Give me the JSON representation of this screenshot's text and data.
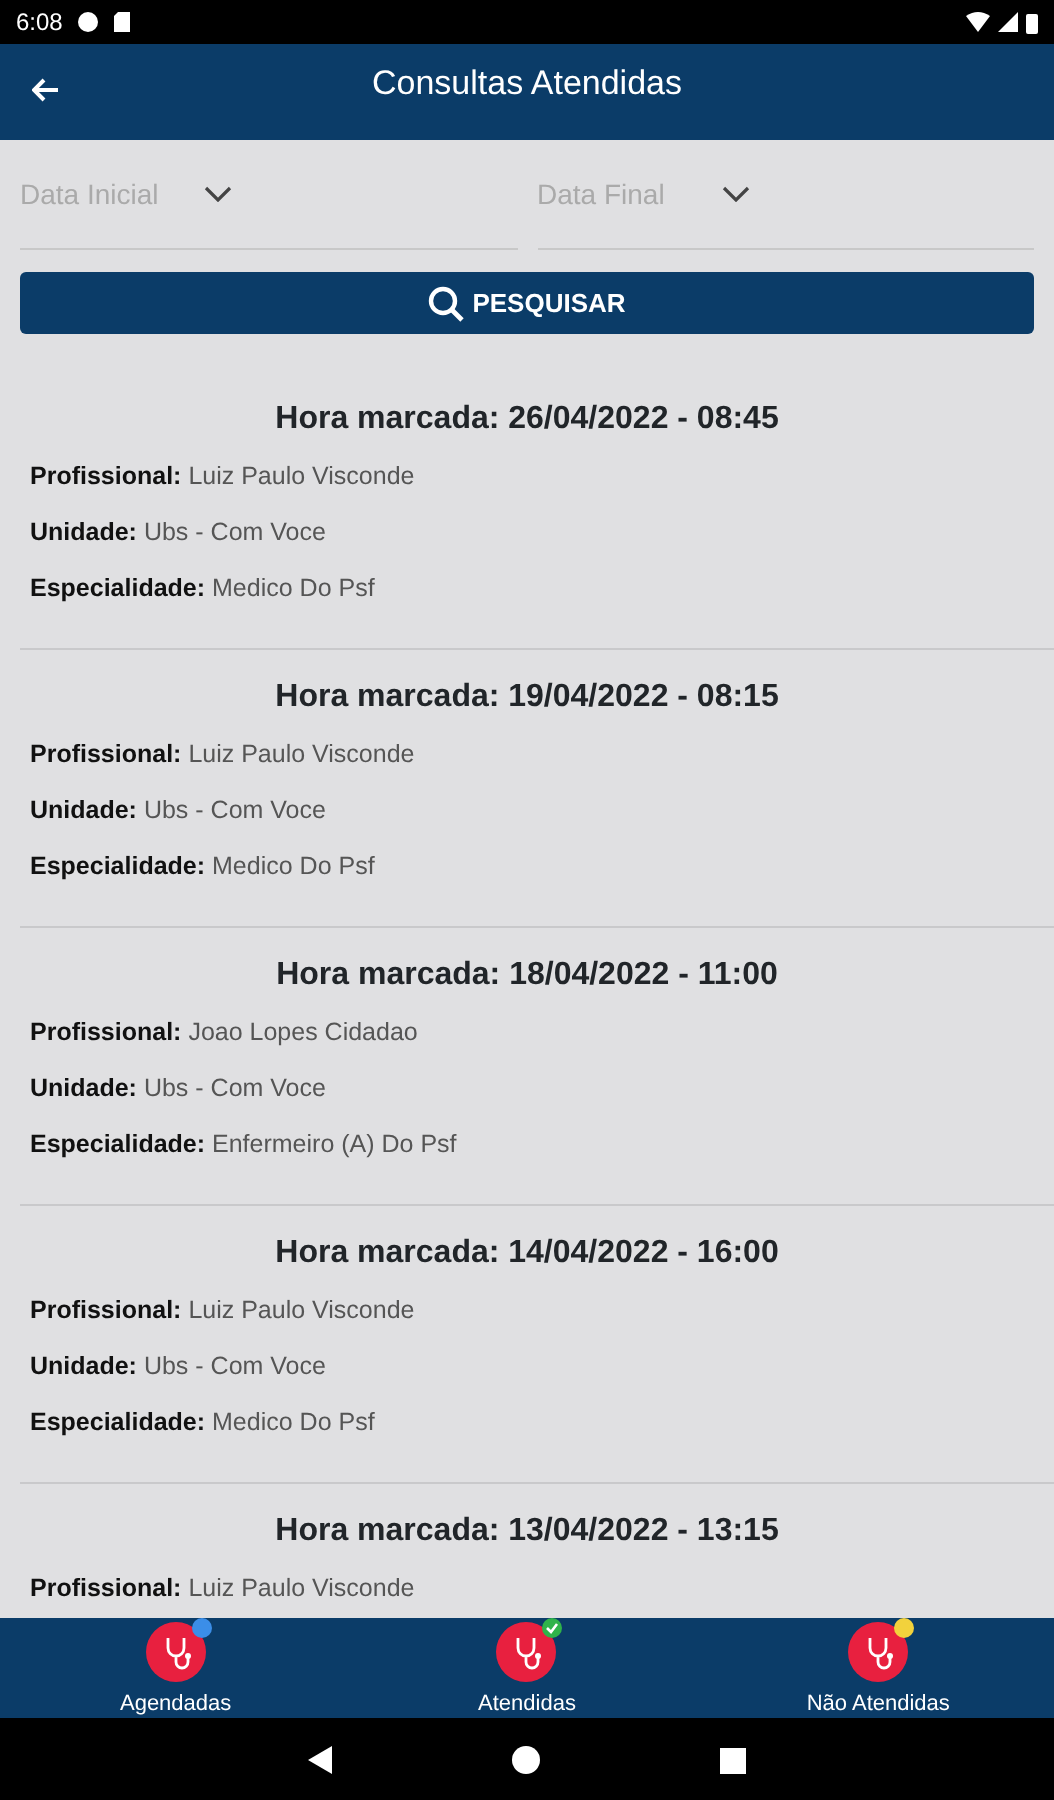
{
  "status_bar": {
    "time": "6:08"
  },
  "header": {
    "title": "Consultas Atendidas"
  },
  "filters": [
    {
      "placeholder": "Data Inicial"
    },
    {
      "placeholder": "Data Final"
    }
  ],
  "search_button": {
    "label": "PESQUISAR"
  },
  "appointments": [
    {
      "title": "Hora marcada: 26/04/2022 - 08:45",
      "fields": [
        {
          "label": "Profissional:",
          "value": "Luiz Paulo Visconde"
        },
        {
          "label": "Unidade:",
          "value": "Ubs - Com Voce"
        },
        {
          "label": "Especialidade:",
          "value": "Medico Do Psf"
        }
      ]
    },
    {
      "title": "Hora marcada: 19/04/2022 - 08:15",
      "fields": [
        {
          "label": "Profissional:",
          "value": "Luiz Paulo Visconde"
        },
        {
          "label": "Unidade:",
          "value": "Ubs - Com Voce"
        },
        {
          "label": "Especialidade:",
          "value": "Medico Do Psf"
        }
      ]
    },
    {
      "title": "Hora marcada: 18/04/2022 - 11:00",
      "fields": [
        {
          "label": "Profissional:",
          "value": "Joao Lopes Cidadao"
        },
        {
          "label": "Unidade:",
          "value": "Ubs - Com Voce"
        },
        {
          "label": "Especialidade:",
          "value": "Enfermeiro (A) Do Psf"
        }
      ]
    },
    {
      "title": "Hora marcada: 14/04/2022 - 16:00",
      "fields": [
        {
          "label": "Profissional:",
          "value": "Luiz Paulo Visconde"
        },
        {
          "label": "Unidade:",
          "value": "Ubs - Com Voce"
        },
        {
          "label": "Especialidade:",
          "value": "Medico Do Psf"
        }
      ]
    },
    {
      "title": "Hora marcada: 13/04/2022 - 13:15",
      "fields": [
        {
          "label": "Profissional:",
          "value": "Luiz Paulo Visconde"
        }
      ]
    }
  ],
  "bottom_nav": [
    {
      "label": "Agendadas",
      "color": "#3b8ee8",
      "kind": "plain"
    },
    {
      "label": "Atendidas",
      "color": "#2fb34a",
      "kind": "check"
    },
    {
      "label": "Não Atendidas",
      "color": "#f2d23c",
      "kind": "plain"
    }
  ]
}
